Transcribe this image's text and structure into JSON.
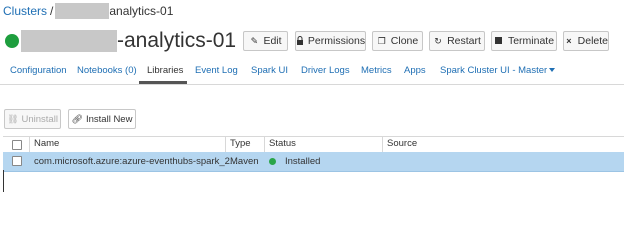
{
  "breadcrumb": {
    "clusters": "Clusters",
    "separator": "/",
    "cluster_suffix": "analytics-01"
  },
  "title": {
    "name_suffix": "-analytics-01"
  },
  "actions": {
    "edit": "Edit",
    "permissions": "Permissions",
    "clone": "Clone",
    "restart": "Restart",
    "terminate": "Terminate",
    "delete": "Delete"
  },
  "tabs": [
    {
      "label": "Configuration"
    },
    {
      "label": "Notebooks (0)"
    },
    {
      "label": "Libraries"
    },
    {
      "label": "Event Log"
    },
    {
      "label": "Spark UI"
    },
    {
      "label": "Driver Logs"
    },
    {
      "label": "Metrics"
    },
    {
      "label": "Apps"
    },
    {
      "label": "Spark Cluster UI - Master"
    }
  ],
  "active_tab": "Libraries",
  "library_actions": {
    "uninstall": "Uninstall",
    "install_new": "Install New"
  },
  "table": {
    "headers": {
      "name": "Name",
      "type": "Type",
      "status": "Status",
      "source": "Source"
    },
    "rows": [
      {
        "name": "com.microsoft.azure:azure-eventhubs-spark_2....",
        "type": "Maven",
        "status": "Installed",
        "source": ""
      }
    ]
  },
  "colors": {
    "accent": "#1f6fb4",
    "running": "#1e9e3e",
    "selected_row": "#b5d6f0"
  }
}
